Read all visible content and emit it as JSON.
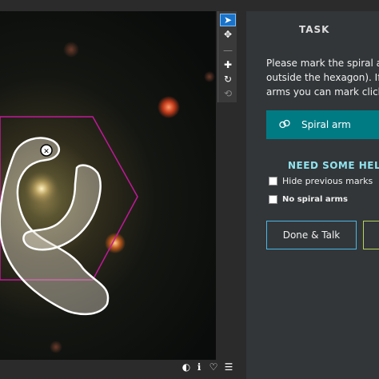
{
  "toolbar": {
    "tools": [
      {
        "name": "pointer",
        "glyph": "➤"
      },
      {
        "name": "move",
        "glyph": "✥"
      },
      {
        "name": "zoom-out",
        "glyph": "—"
      },
      {
        "name": "zoom-in",
        "glyph": "✚"
      },
      {
        "name": "rotate",
        "glyph": "↻"
      },
      {
        "name": "reset",
        "glyph": "⟲"
      }
    ]
  },
  "viewer": {
    "footer_icons": [
      "contrast-icon",
      "info-icon",
      "heart-icon",
      "list-icon"
    ],
    "footer_glyphs": {
      "contrast": "◐",
      "info": "ℹ",
      "heart": "♡",
      "list": "☰"
    },
    "close_mark_glyph": "✕"
  },
  "task": {
    "title": "TASK",
    "instructions": [
      "Please mark the spiral ar",
      "outside the hexagon). If y",
      "arms you can mark click"
    ],
    "spiral_arm_label": "Spiral arm",
    "help_label": "NEED SOME HELP",
    "options": [
      {
        "label": "Hide previous marks"
      },
      {
        "label": "No spiral arms"
      }
    ],
    "done_talk_label": "Done & Talk"
  },
  "colors": {
    "accent_teal": "#007b84",
    "help_text": "#8fe3ee",
    "hexagon": "#c2189a",
    "done_talk_border": "#4ab8e6",
    "done_border": "#b6d45a"
  }
}
